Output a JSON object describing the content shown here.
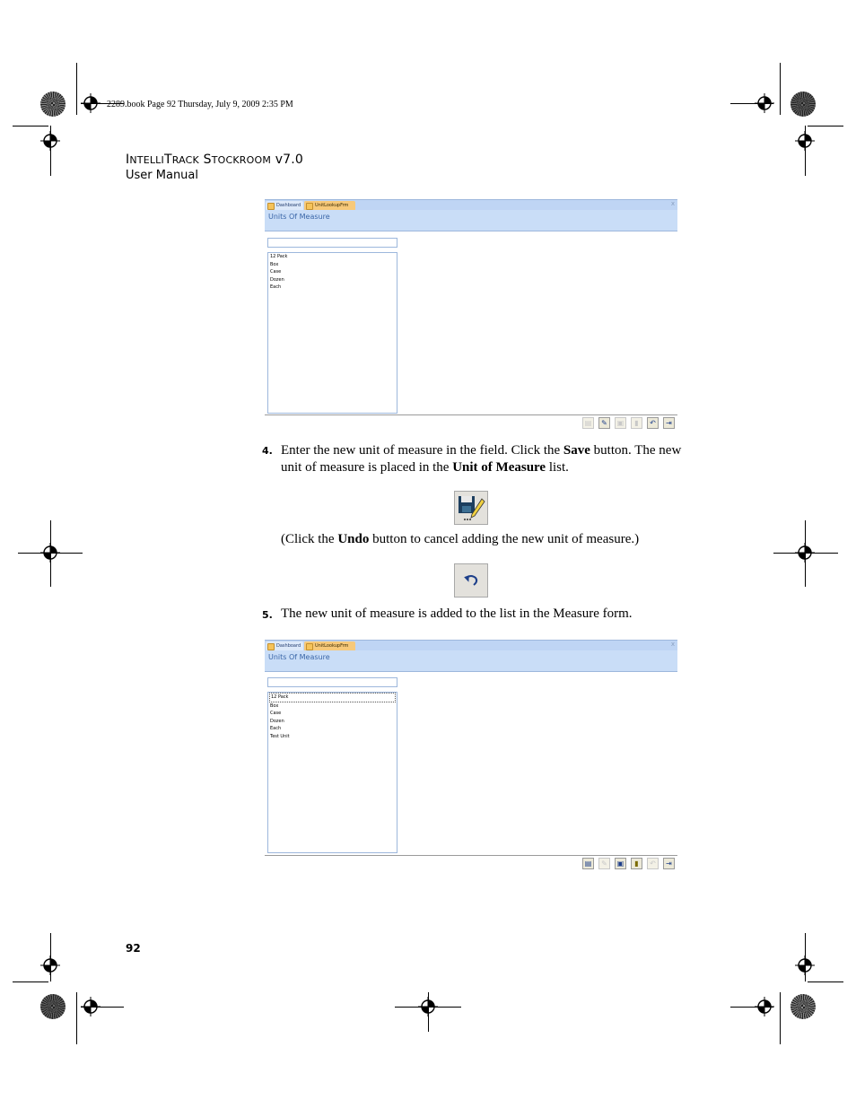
{
  "header": {
    "book_line": "2289.book  Page 92  Thursday, July 9, 2009  2:35 PM",
    "title_I": "I",
    "title_ntelli": "NTELLI",
    "title_T": "T",
    "title_rack": "RACK",
    "title_S": "S",
    "title_tockroom": "TOCKROOM",
    "title_version": "v7.0",
    "subtitle": "User Manual"
  },
  "screenshot1": {
    "tab_dashboard": "Dashboard",
    "tab_form": "UnitLookupFrm",
    "close": "x",
    "form_title": "Units Of Measure",
    "items": [
      "12 Pack",
      "Box",
      "Case",
      "Dozen",
      "Each"
    ]
  },
  "screenshot2": {
    "tab_dashboard": "Dashboard",
    "tab_form": "UnitLookupFrm",
    "close": "x",
    "form_title": "Units Of Measure",
    "items": [
      "12 Pack",
      "Box",
      "Case",
      "Dozen",
      "Each",
      "Test Unit"
    ]
  },
  "steps": {
    "step4_num": "4.",
    "step4_a": "Enter the new unit of measure in the field. Click the ",
    "step4_save": "Save",
    "step4_b": " button. The new unit of measure is placed in the ",
    "step4_uom": "Unit of Measure",
    "step4_c": " list.",
    "undo_a": "(Click the ",
    "undo_b": "Undo",
    "undo_c": " button to cancel adding the new unit of measure.)",
    "step5_num": "5.",
    "step5_text": "The new unit of measure is added to the list in the Measure form."
  },
  "footer": {
    "page_number": "92"
  },
  "icons": {
    "save_button_icon": "floppy-pencil-icon",
    "undo_button_icon": "undo-arrow-icon"
  }
}
